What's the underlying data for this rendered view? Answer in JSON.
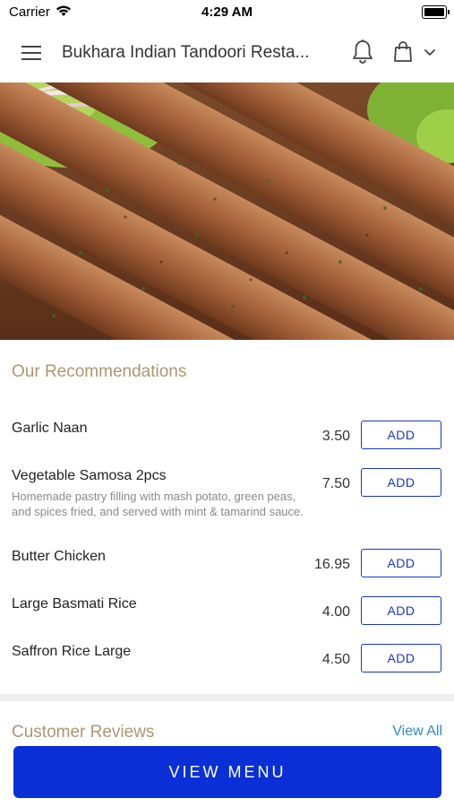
{
  "status_bar": {
    "carrier": "Carrier",
    "time": "4:29 AM"
  },
  "header": {
    "title": "Bukhara Indian Tandoori Resta...",
    "icons": [
      "menu-icon",
      "bell-icon",
      "shopping-bag-icon",
      "chevron-down-icon"
    ]
  },
  "hero": {
    "description": "seekh kebab photo"
  },
  "recommendations": {
    "title": "Our Recommendations",
    "add_label": "ADD",
    "items": [
      {
        "name": "Garlic Naan",
        "description": "",
        "price": "3.50"
      },
      {
        "name": "Vegetable Samosa 2pcs",
        "description": "Homemade pastry filling with mash potato, green peas, and spices fried, and served with mint & tamarind sauce.",
        "price": "7.50"
      },
      {
        "name": "Butter Chicken",
        "description": "",
        "price": "16.95"
      },
      {
        "name": "Large Basmati Rice",
        "description": "",
        "price": "4.00"
      },
      {
        "name": "Saffron Rice Large",
        "description": "",
        "price": "4.50"
      }
    ]
  },
  "reviews": {
    "title": "Customer Reviews",
    "view_all": "View All"
  },
  "footer": {
    "view_menu": "VIEW MENU"
  },
  "colors": {
    "accent_blue": "#0a2fd6",
    "add_border": "#1a36c4",
    "section_title": "#a99773",
    "link": "#2a8fbf"
  }
}
